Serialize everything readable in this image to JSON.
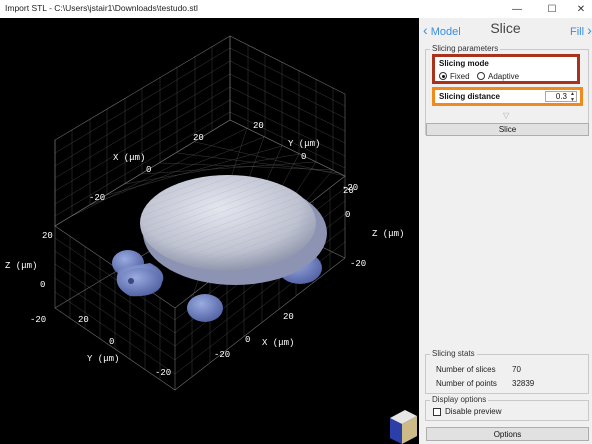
{
  "window": {
    "title": "Import STL - C:\\Users\\jstair1\\Downloads\\testudo.stl",
    "minimize_glyph": "—",
    "maximize_glyph": "☐",
    "close_glyph": "✕"
  },
  "panel": {
    "back_label": "Model",
    "title": "Slice",
    "next_label": "Fill",
    "slicing_parameters": {
      "label": "Slicing parameters",
      "mode_label": "Slicing mode",
      "mode_options": [
        "Fixed",
        "Adaptive"
      ],
      "mode_selected": "Fixed",
      "distance_label": "Slicing distance",
      "distance_value": "0.3"
    },
    "slice_button": "Slice",
    "stats": {
      "label": "Slicing stats",
      "slices_label": "Number of slices",
      "slices_value": "70",
      "points_label": "Number of points",
      "points_value": "32839"
    },
    "display_options": {
      "label": "Display options",
      "disable_preview_label": "Disable preview",
      "disable_preview_checked": false
    },
    "options_button": "Options"
  },
  "viewport": {
    "background": "#000000",
    "model_color": "#6f82c4",
    "shell_color": "#c8cbd6",
    "axis_labels": {
      "x_top": "X (μm)",
      "y_top": "Y (μm)",
      "z_left": "Z (μm)",
      "z_right": "Z (μm)",
      "y_bottom": "Y (μm)",
      "x_bottom": "X (μm)"
    },
    "tick_labels": {
      "x_top": [
        "20",
        "0",
        "-20"
      ],
      "y_top": [
        "20",
        "0",
        "-20"
      ],
      "z_left": [
        "20",
        "0",
        "-20"
      ],
      "z_right": [
        "20",
        "0",
        "-20"
      ],
      "y_bottom": [
        "20",
        "0",
        "-20"
      ],
      "x_bottom": [
        "20",
        "0",
        "-20"
      ]
    }
  },
  "colors": {
    "accent": "#3a8dde",
    "highlight_mode": "#a8321b",
    "highlight_distance": "#f08a1c",
    "panel_bg": "#f0f0f0"
  }
}
